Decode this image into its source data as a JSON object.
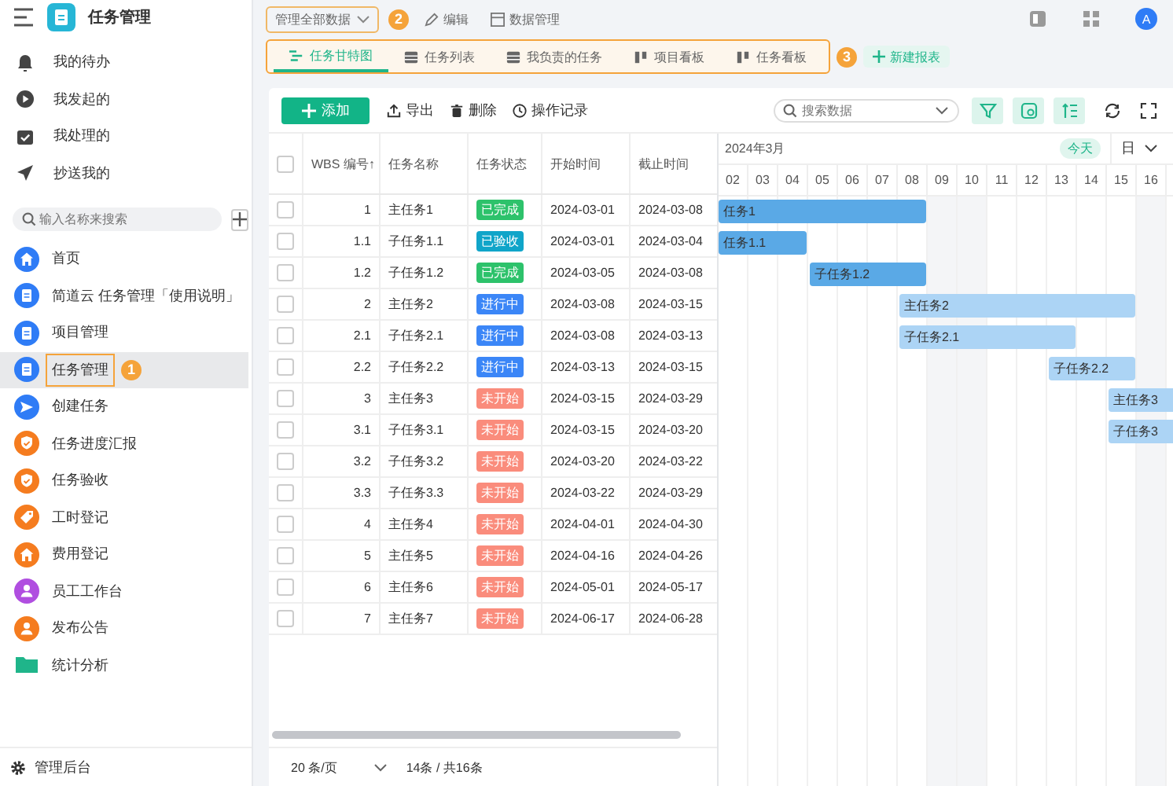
{
  "sidebar": {
    "app_title": "任务管理",
    "quick_items": [
      {
        "label": "我的待办"
      },
      {
        "label": "我发起的"
      },
      {
        "label": "我处理的"
      },
      {
        "label": "抄送我的"
      }
    ],
    "search": {
      "placeholder": "输入名称来搜索"
    },
    "items": [
      {
        "color": "#2f7cf6",
        "label": "首页",
        "selected": false
      },
      {
        "color": "#2f7cf6",
        "label": "简道云 任务管理「使用说明」",
        "selected": false
      },
      {
        "color": "#2f7cf6",
        "label": "项目管理",
        "selected": false
      },
      {
        "color": "#2f7cf6",
        "label": "任务管理",
        "selected": true,
        "badge": "1"
      },
      {
        "color": "#2f7cf6",
        "label": "创建任务",
        "selected": false
      },
      {
        "color": "#f57c1f",
        "label": "任务进度汇报",
        "selected": false
      },
      {
        "color": "#f57c1f",
        "label": "任务验收",
        "selected": false
      },
      {
        "color": "#f57c1f",
        "label": "工时登记",
        "selected": false
      },
      {
        "color": "#f57c1f",
        "label": "费用登记",
        "selected": false
      },
      {
        "color": "#b04ee0",
        "label": "员工工作台",
        "selected": false
      },
      {
        "color": "#f57c1f",
        "label": "发布公告",
        "selected": false
      },
      {
        "color": "#1fb58a",
        "label": "统计分析",
        "selected": false
      }
    ],
    "footer": "管理后台"
  },
  "header": {
    "dropdown": "管理全部数据",
    "badge": "2",
    "edit": "编辑",
    "data_manage": "数据管理",
    "avatar": "A"
  },
  "views": {
    "tabs": [
      {
        "label": "任务甘特图",
        "selected": true
      },
      {
        "label": "任务列表",
        "selected": false
      },
      {
        "label": "我负责的任务",
        "selected": false
      },
      {
        "label": "项目看板",
        "selected": false
      },
      {
        "label": "任务看板",
        "selected": false
      }
    ],
    "badge": "3",
    "new_report": "新建报表"
  },
  "toolbar": {
    "add": "添加",
    "export": "导出",
    "delete": "删除",
    "log": "操作记录",
    "search": {
      "placeholder": "搜索数据"
    }
  },
  "table": {
    "all_checked": false,
    "columns": [
      "WBS 编号↑",
      "任务名称",
      "任务状态",
      "开始时间",
      "截止时间"
    ],
    "rows": [
      {
        "wbs": "1",
        "name": "主任务1",
        "status": "已完成",
        "kind": "completed",
        "start": "2024-03-01",
        "end": "2024-03-08",
        "bar_label": "任务1",
        "checked": false
      },
      {
        "wbs": "1.1",
        "name": "子任务1.1",
        "status": "已验收",
        "kind": "accepted",
        "start": "2024-03-01",
        "end": "2024-03-04",
        "bar_label": "任务1.1",
        "checked": false
      },
      {
        "wbs": "1.2",
        "name": "子任务1.2",
        "status": "已完成",
        "kind": "completed",
        "start": "2024-03-05",
        "end": "2024-03-08",
        "bar_label": "子任务1.2",
        "checked": false
      },
      {
        "wbs": "2",
        "name": "主任务2",
        "status": "进行中",
        "kind": "in_progress",
        "start": "2024-03-08",
        "end": "2024-03-15",
        "bar_label": "主任务2",
        "checked": false
      },
      {
        "wbs": "2.1",
        "name": "子任务2.1",
        "status": "进行中",
        "kind": "in_progress",
        "start": "2024-03-08",
        "end": "2024-03-13",
        "bar_label": "子任务2.1",
        "checked": false
      },
      {
        "wbs": "2.2",
        "name": "子任务2.2",
        "status": "进行中",
        "kind": "in_progress",
        "start": "2024-03-13",
        "end": "2024-03-15",
        "bar_label": "子任务2.2",
        "checked": false
      },
      {
        "wbs": "3",
        "name": "主任务3",
        "status": "未开始",
        "kind": "not_started",
        "start": "2024-03-15",
        "end": "2024-03-29",
        "bar_label": "主任务3",
        "checked": false
      },
      {
        "wbs": "3.1",
        "name": "子任务3.1",
        "status": "未开始",
        "kind": "not_started",
        "start": "2024-03-15",
        "end": "2024-03-20",
        "bar_label": "子任务3",
        "checked": false
      },
      {
        "wbs": "3.2",
        "name": "子任务3.2",
        "status": "未开始",
        "kind": "not_started",
        "start": "2024-03-20",
        "end": "2024-03-22",
        "checked": false
      },
      {
        "wbs": "3.3",
        "name": "子任务3.3",
        "status": "未开始",
        "kind": "not_started",
        "start": "2024-03-22",
        "end": "2024-03-29",
        "checked": false
      },
      {
        "wbs": "4",
        "name": "主任务4",
        "status": "未开始",
        "kind": "not_started",
        "start": "2024-04-01",
        "end": "2024-04-30",
        "checked": false
      },
      {
        "wbs": "5",
        "name": "主任务5",
        "status": "未开始",
        "kind": "not_started",
        "start": "2024-04-16",
        "end": "2024-04-26",
        "checked": false
      },
      {
        "wbs": "6",
        "name": "主任务6",
        "status": "未开始",
        "kind": "not_started",
        "start": "2024-05-01",
        "end": "2024-05-17",
        "checked": false
      },
      {
        "wbs": "7",
        "name": "主任务7",
        "status": "未开始",
        "kind": "not_started",
        "start": "2024-06-17",
        "end": "2024-06-28",
        "checked": false
      }
    ]
  },
  "gantt": {
    "month": "2024年3月",
    "today": "今天",
    "scale": "日",
    "days": [
      "02",
      "03",
      "04",
      "05",
      "06",
      "07",
      "08",
      "09",
      "10",
      "11",
      "12",
      "13",
      "14",
      "15",
      "16"
    ]
  },
  "pagination": {
    "page_size": "20 条/页",
    "summary": "14条 / 共16条"
  }
}
